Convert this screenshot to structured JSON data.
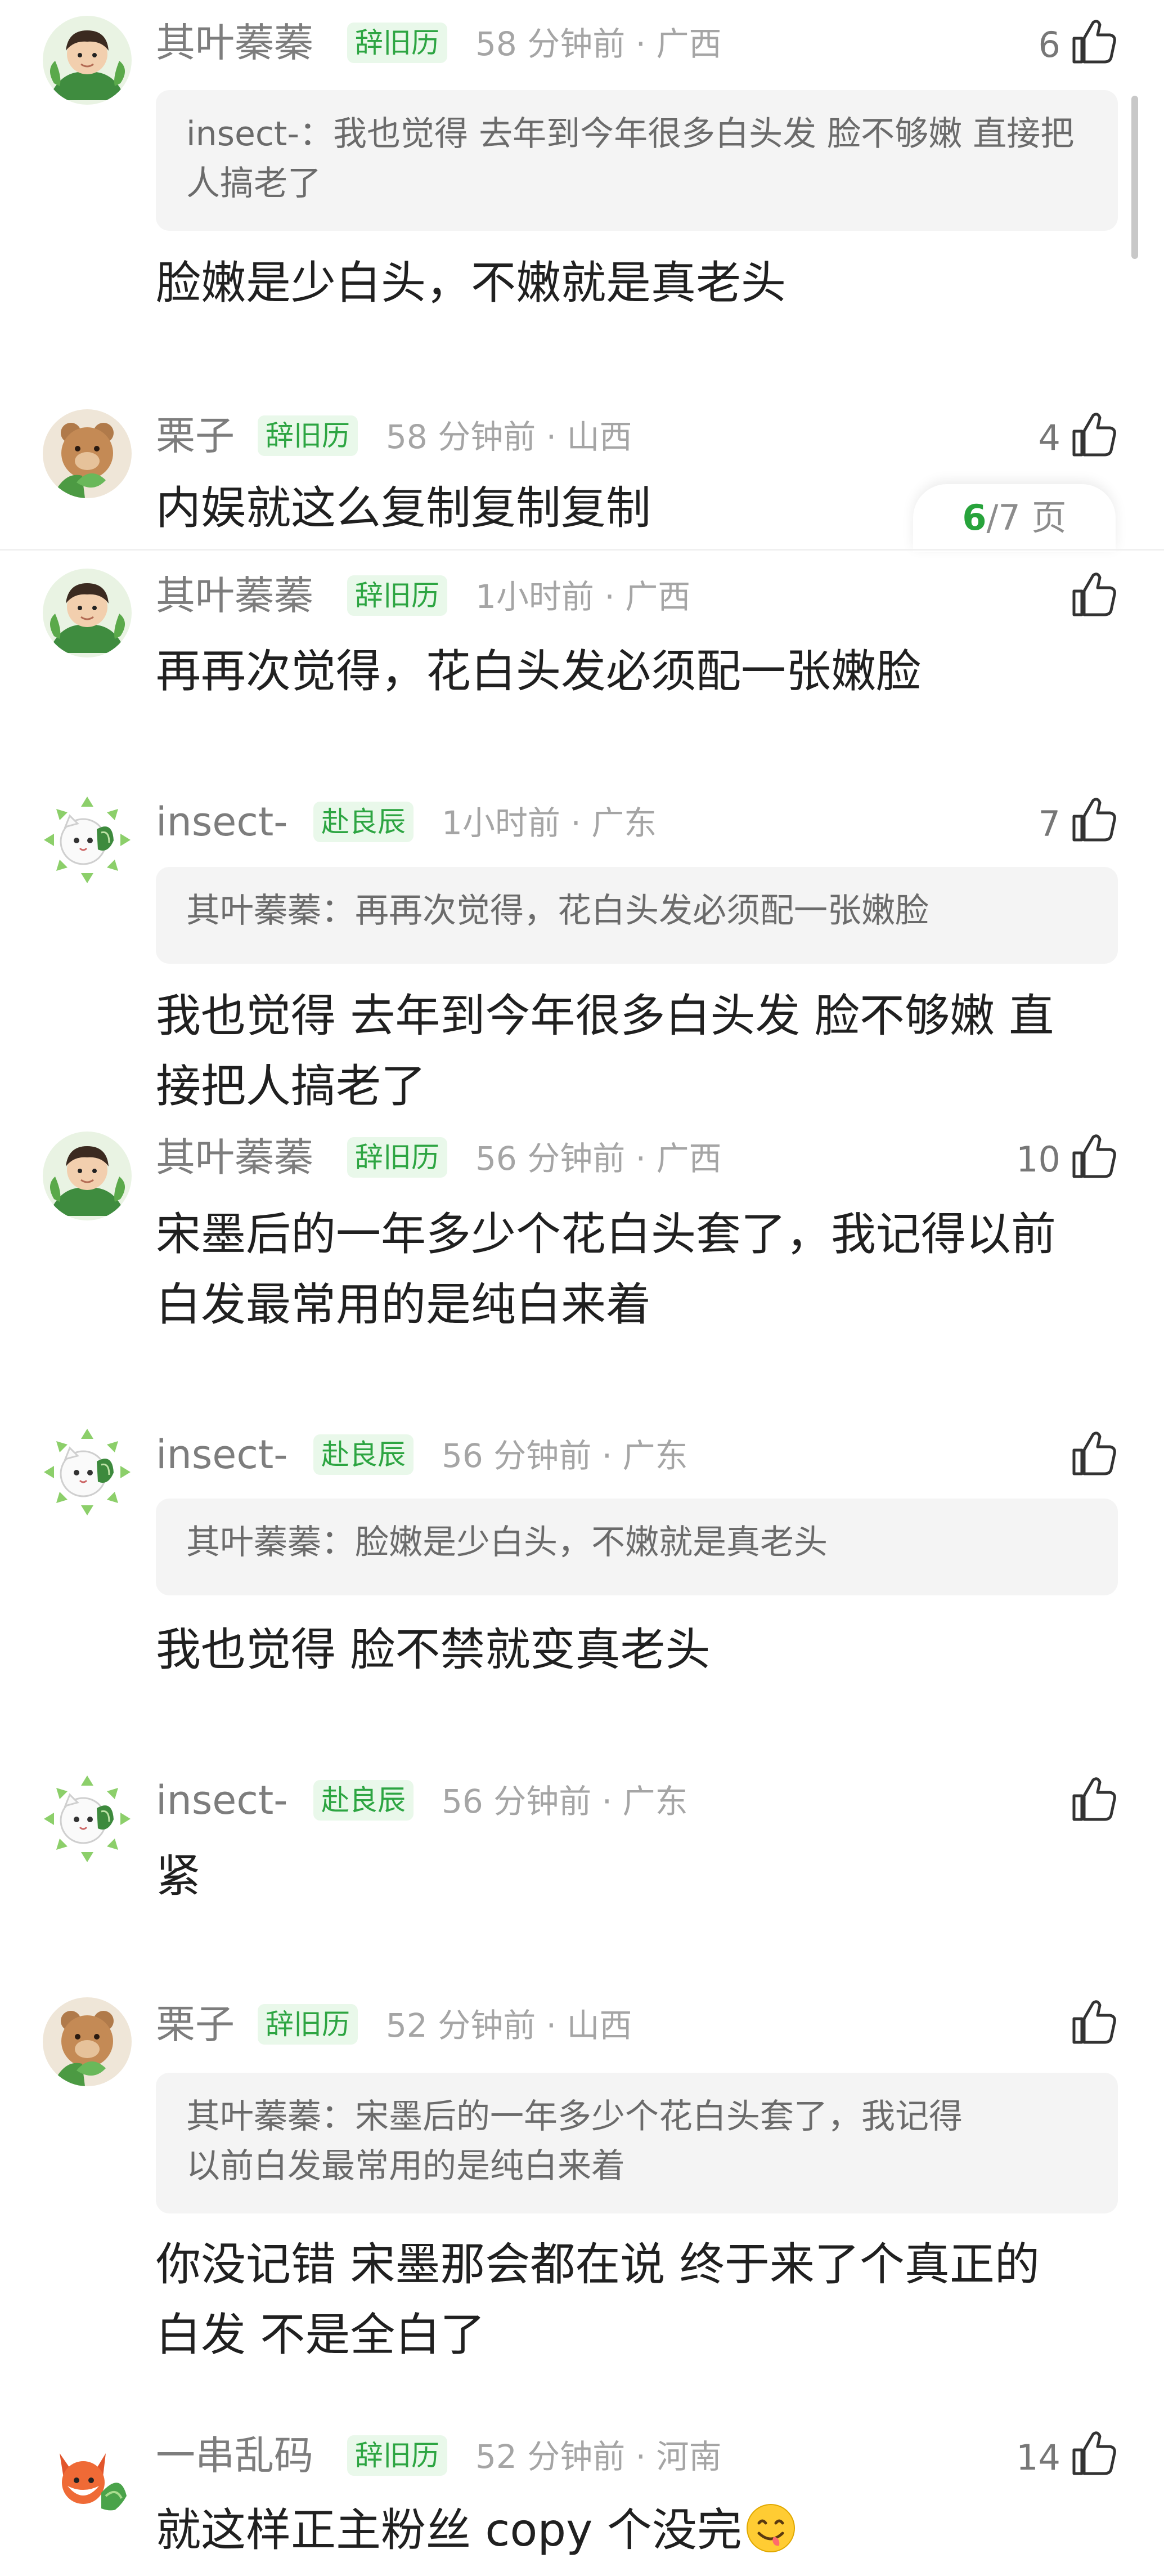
{
  "colors": {
    "accent": "#2da542",
    "badge_bg": "#e9f8ea",
    "quote_bg": "#f4f4f4"
  },
  "pager": {
    "current": "6",
    "total": "/7 页"
  },
  "comments": [
    {
      "user": "其叶蓁蓁",
      "badge": "辞旧历",
      "meta": "58 分钟前 · 广西",
      "likes": "6",
      "quote": "insect-：我也觉得 去年到今年很多白头发 脸不够嫩 直接把人搞老了",
      "text": "脸嫩是少白头，不嫩就是真老头"
    },
    {
      "user": "栗子",
      "badge": "辞旧历",
      "meta": "58 分钟前 · 山西",
      "likes": "4",
      "text": "内娱就这么复制复制复制"
    },
    {
      "user": "其叶蓁蓁",
      "badge": "辞旧历",
      "meta": "1小时前 · 广西",
      "likes": "",
      "text": "再再次觉得，花白头发必须配一张嫩脸"
    },
    {
      "user": "insect-",
      "badge": "赴良辰",
      "meta": "1小时前 · 广东",
      "likes": "7",
      "quote": "其叶蓁蓁：再再次觉得，花白头发必须配一张嫩脸",
      "text_lines": [
        "我也觉得 去年到今年很多白头发 脸不够嫩 直",
        "接把人搞老了"
      ]
    },
    {
      "user": "其叶蓁蓁",
      "badge": "辞旧历",
      "meta": "56 分钟前 · 广西",
      "likes": "10",
      "text_lines": [
        "宋墨后的一年多少个花白头套了，我记得以前",
        "白发最常用的是纯白来着"
      ]
    },
    {
      "user": "insect-",
      "badge": "赴良辰",
      "meta": "56 分钟前 · 广东",
      "likes": "",
      "quote": "其叶蓁蓁：脸嫩是少白头，不嫩就是真老头",
      "text": "我也觉得 脸不禁就变真老头"
    },
    {
      "user": "insect-",
      "badge": "赴良辰",
      "meta": "56 分钟前 · 广东",
      "likes": "",
      "text": "紧"
    },
    {
      "user": "栗子",
      "badge": "辞旧历",
      "meta": "52 分钟前 · 山西",
      "likes": "",
      "quote_lines": [
        "其叶蓁蓁：宋墨后的一年多少个花白头套了，我记得",
        "以前白发最常用的是纯白来着"
      ],
      "text_lines": [
        "你没记错 宋墨那会都在说 终于来了个真正的",
        "白发 不是全白了"
      ]
    },
    {
      "user": "一串乱码",
      "badge": "辞旧历",
      "meta": "52 分钟前 · 河南",
      "likes": "14",
      "text": "就这样正主粉丝 copy 个没完",
      "text_emoji": "yum-face-icon"
    }
  ]
}
